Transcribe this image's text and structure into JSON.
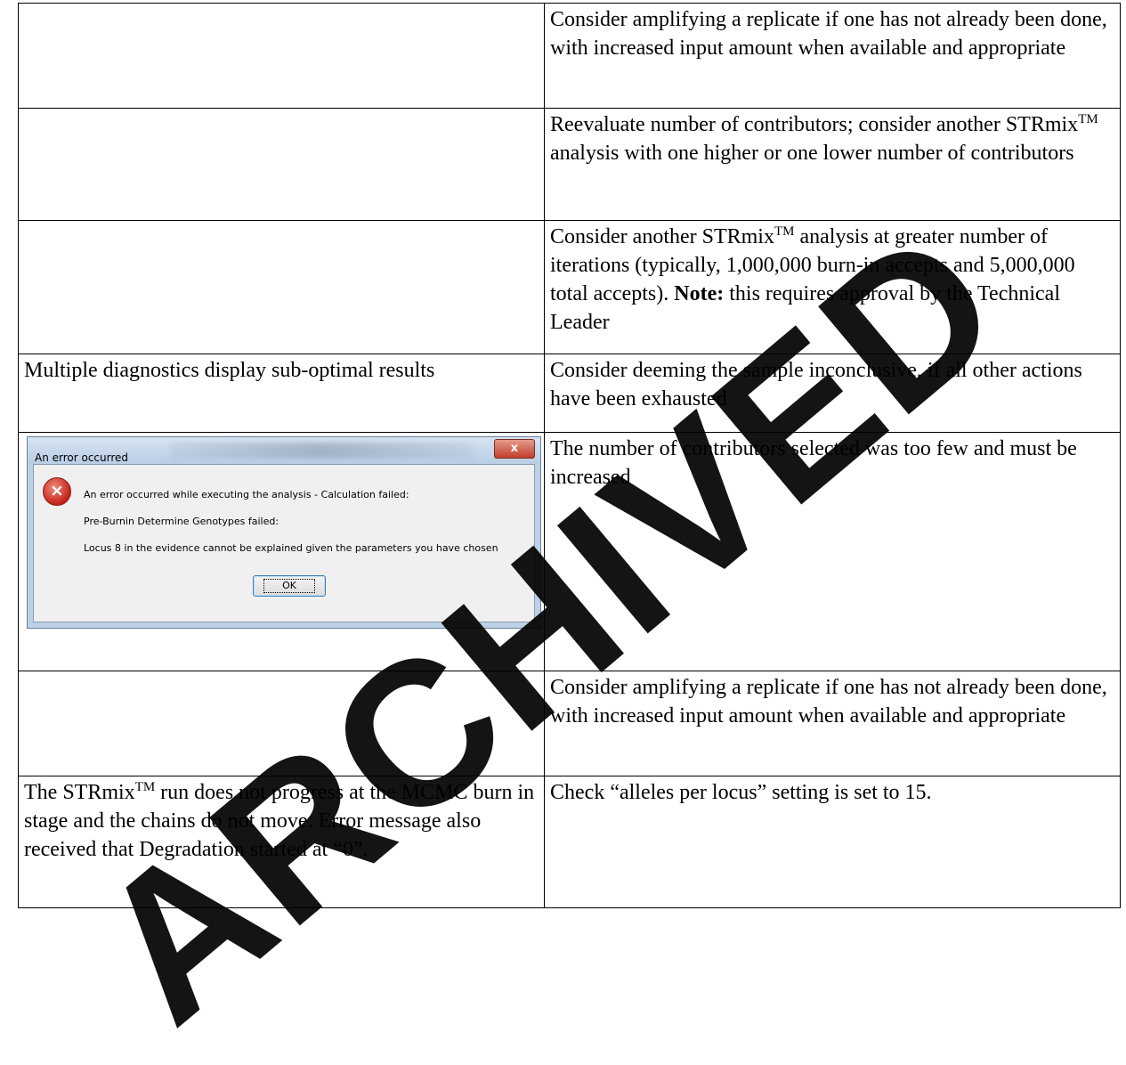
{
  "rows": [
    {
      "left": "",
      "right": "Consider amplifying a replicate if one has not already been done, with increased input amount when available and appropriate"
    },
    {
      "left": "",
      "right_pre": "Reevaluate number of contributors; consider another STRmix",
      "right_tm": "TM",
      "right_post": " analysis with one higher or one lower number of contributors"
    },
    {
      "left": "",
      "right_pre": "Consider another STRmix",
      "right_tm": "TM",
      "right_mid": " analysis at greater number of iterations (typically, 1,000,000 burn-in accepts and 5,000,000 total accepts). ",
      "right_note": "Note:",
      "right_post": " this requires approval by the Technical Leader"
    },
    {
      "left": "Multiple diagnostics display sub-optimal results",
      "right": "Consider deeming the sample inconclusive, if all other actions have been exhausted"
    },
    {
      "right": "The number of contributors selected was too few and must be increased"
    },
    {
      "left": "",
      "right": "Consider amplifying a replicate if one has not already been done, with increased input amount when available and appropriate"
    },
    {
      "left_pre": "The STRmix",
      "left_tm": "TM",
      "left_post": " run does not progress at the MCMC burn in stage and the chains do not move. Error message also received that Degradation started at “0”.",
      "right": "Check “alleles per locus” setting is set to 15."
    }
  ],
  "dialog": {
    "title": "An error occurred",
    "close_glyph": "x",
    "icon_glyph": "×",
    "message_1": "An error occurred while executing the analysis - Calculation failed:",
    "message_2": "Pre-Burnin Determine Genotypes failed:",
    "message_3": "Locus 8 in the evidence cannot be explained given the parameters you have chosen",
    "ok_label": "OK"
  },
  "watermark": "ARCHIVED"
}
